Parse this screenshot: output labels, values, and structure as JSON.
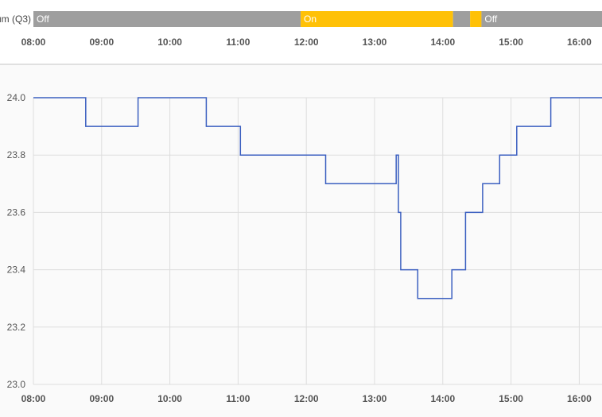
{
  "chart_data": [
    {
      "type": "timeline",
      "row_label": "um (Q3)",
      "x_range": [
        "08:00",
        "16:20"
      ],
      "x_ticks": [
        "08:00",
        "09:00",
        "10:00",
        "11:00",
        "12:00",
        "13:00",
        "14:00",
        "15:00",
        "16:00"
      ],
      "segments": [
        {
          "start": "08:00",
          "end": "11:55",
          "state": "Off",
          "label": "Off"
        },
        {
          "start": "11:55",
          "end": "14:09",
          "state": "On",
          "label": "On"
        },
        {
          "start": "14:09",
          "end": "14:24",
          "state": "Off",
          "label": ""
        },
        {
          "start": "14:24",
          "end": "14:34",
          "state": "On",
          "label": ""
        },
        {
          "start": "14:34",
          "end": "16:20",
          "state": "Off",
          "label": "Off"
        }
      ],
      "colors": {
        "On": "#ffc107",
        "Off": "#9e9e9e"
      }
    },
    {
      "type": "line",
      "step": true,
      "x_range": [
        "08:00",
        "16:20"
      ],
      "x_ticks": [
        "08:00",
        "09:00",
        "10:00",
        "11:00",
        "12:00",
        "13:00",
        "14:00",
        "15:00",
        "16:00"
      ],
      "ylim": [
        23.0,
        24.0
      ],
      "y_ticks": [
        "23.0",
        "23.2",
        "23.4",
        "23.6",
        "23.8",
        "24.0"
      ],
      "grid": true,
      "color": "#3b5fc0",
      "points": [
        [
          "08:00",
          24.0
        ],
        [
          "08:46",
          23.9
        ],
        [
          "09:32",
          24.0
        ],
        [
          "10:32",
          23.9
        ],
        [
          "11:02",
          23.8
        ],
        [
          "12:17",
          23.7
        ],
        [
          "13:19",
          23.8
        ],
        [
          "13:21",
          23.6
        ],
        [
          "13:23",
          23.4
        ],
        [
          "13:38",
          23.3
        ],
        [
          "14:08",
          23.4
        ],
        [
          "14:20",
          23.6
        ],
        [
          "14:35",
          23.7
        ],
        [
          "14:50",
          23.8
        ],
        [
          "15:05",
          23.9
        ],
        [
          "15:35",
          24.0
        ],
        [
          "16:20",
          24.0
        ]
      ]
    }
  ]
}
